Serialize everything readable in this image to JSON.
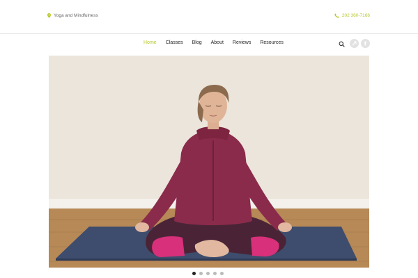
{
  "header": {
    "tagline": "Yoga and Mindfulness",
    "tagline_icon": "map-pin-icon",
    "phone": "202 360-7166",
    "phone_icon": "phone-icon",
    "accent_color": "#b7c72b"
  },
  "nav": {
    "items": [
      {
        "label": "Home",
        "active": true
      },
      {
        "label": "Classes",
        "active": false
      },
      {
        "label": "Blog",
        "active": false
      },
      {
        "label": "About",
        "active": false
      },
      {
        "label": "Reviews",
        "active": false
      },
      {
        "label": "Resources",
        "active": false
      }
    ],
    "search_icon": "search-icon",
    "social_icons": [
      "social-icon-1",
      "social-icon-2"
    ]
  },
  "slider": {
    "image": "woman-meditating-on-yoga-mat-photo",
    "slide_count": 5,
    "active_slide": 1
  }
}
